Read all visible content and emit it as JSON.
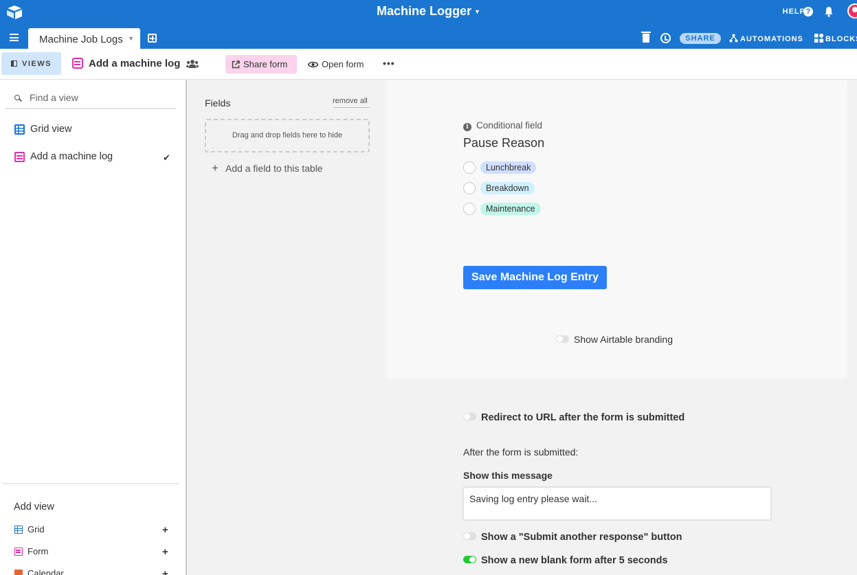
{
  "header": {
    "base_title": "Machine Logger",
    "help_label": "HELP",
    "table_tab": "Machine Job Logs",
    "share_label": "SHARE",
    "automations_label": "AUTOMATIONS",
    "blocks_label": "BLOCKS"
  },
  "viewbar": {
    "views_label": "VIEWS",
    "current_view": "Add a machine log",
    "share_form_label": "Share form",
    "open_form_label": "Open form",
    "more_label": "•••"
  },
  "sidebar": {
    "search_placeholder": "Find a view",
    "views": [
      {
        "label": "Grid view",
        "type": "grid"
      },
      {
        "label": "Add a machine log",
        "type": "form",
        "selected": true
      }
    ],
    "add_view_title": "Add view",
    "add_view_items": [
      {
        "label": "Grid"
      },
      {
        "label": "Form"
      },
      {
        "label": "Calendar"
      }
    ]
  },
  "fields_panel": {
    "title": "Fields",
    "remove_all": "remove all",
    "drop_zone_text": "Drag and drop fields here to hide",
    "add_field": "Add a field to this table"
  },
  "form": {
    "conditional_label": "Conditional field",
    "field_title": "Pause Reason",
    "options": [
      {
        "label": "Lunchbreak",
        "color": "#cfdfff"
      },
      {
        "label": "Breakdown",
        "color": "#d0f0fd"
      },
      {
        "label": "Maintenance",
        "color": "#c2f5e9"
      }
    ],
    "submit_label": "Save Machine Log Entry",
    "branding_label": "Show Airtable branding"
  },
  "settings": {
    "redirect_label": "Redirect to URL after the form is submitted",
    "after_submit_label": "After the form is submitted:",
    "show_message_label": "Show this message",
    "message_value": "Saving log entry please wait...",
    "submit_another_label": "Show a \"Submit another response\" button",
    "new_blank_label": "Show a new blank form after 5 seconds"
  },
  "colors": {
    "topbar": "#1a76d1",
    "accent_button": "#2d7ff9",
    "form_pink": "#e02fa6",
    "toggle_on": "#20c933"
  }
}
